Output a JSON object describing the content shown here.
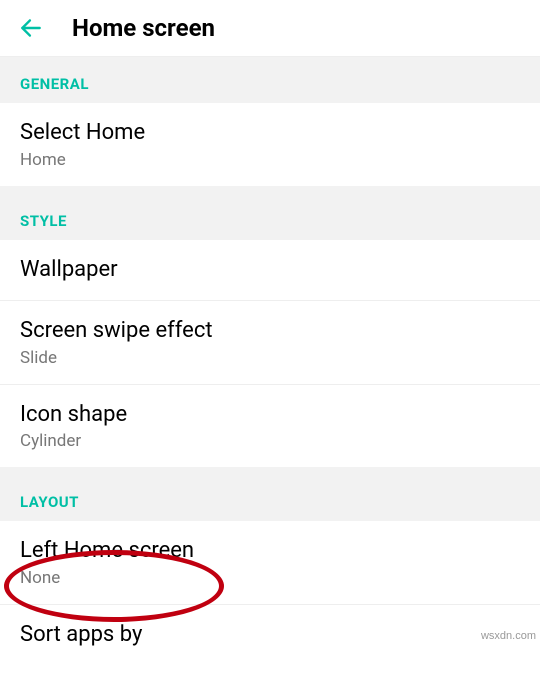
{
  "header": {
    "title": "Home screen"
  },
  "sections": {
    "general": {
      "label": "GENERAL",
      "selectHome": {
        "title": "Select Home",
        "sub": "Home"
      }
    },
    "style": {
      "label": "STYLE",
      "wallpaper": {
        "title": "Wallpaper"
      },
      "swipe": {
        "title": "Screen swipe effect",
        "sub": "Slide"
      },
      "iconShape": {
        "title": "Icon shape",
        "sub": "Cylinder"
      }
    },
    "layout": {
      "label": "LAYOUT",
      "leftHome": {
        "title": "Left Home screen",
        "sub": "None"
      },
      "sortApps": {
        "title": "Sort apps by"
      }
    }
  },
  "watermark": "wsxdn.com"
}
